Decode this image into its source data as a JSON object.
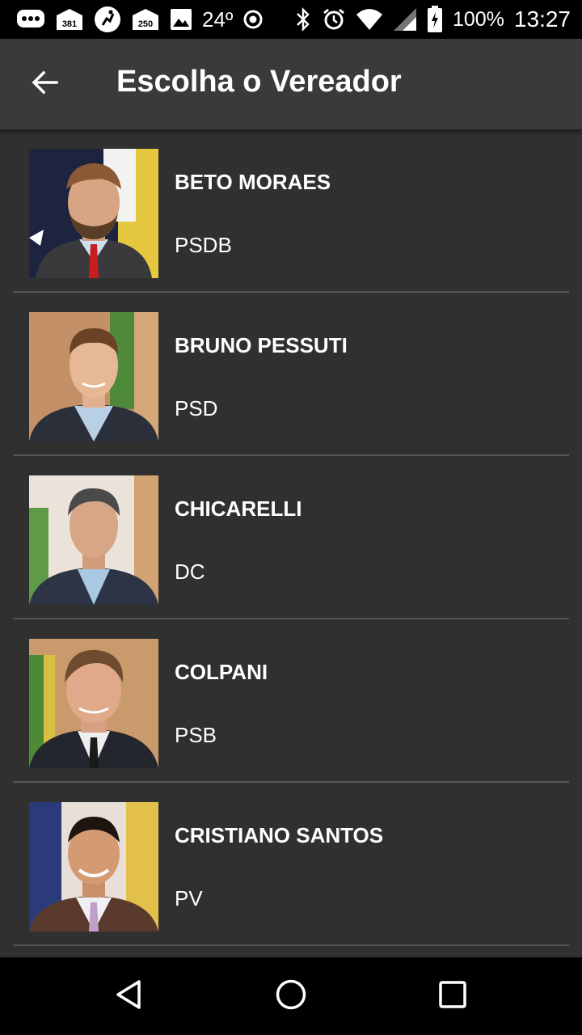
{
  "status_bar": {
    "notification_icons": [
      "chat-bubble-icon",
      "mail-381-icon",
      "activity-icon",
      "mail-250-icon",
      "image-icon"
    ],
    "badge_381": "381",
    "badge_250": "250",
    "temperature": "24º",
    "battery_percent": "100%",
    "time": "13:27"
  },
  "app_bar": {
    "title": "Escolha o Vereador"
  },
  "councilors": [
    {
      "name": "BETO MORAES",
      "party": "PSDB"
    },
    {
      "name": "BRUNO PESSUTI",
      "party": "PSD"
    },
    {
      "name": "CHICARELLI",
      "party": "DC"
    },
    {
      "name": "COLPANI",
      "party": "PSB"
    },
    {
      "name": "CRISTIANO SANTOS",
      "party": "PV"
    }
  ],
  "colors": {
    "background": "#303030",
    "app_bar": "#3a3a3a",
    "divider": "#555555",
    "text": "#ffffff"
  }
}
